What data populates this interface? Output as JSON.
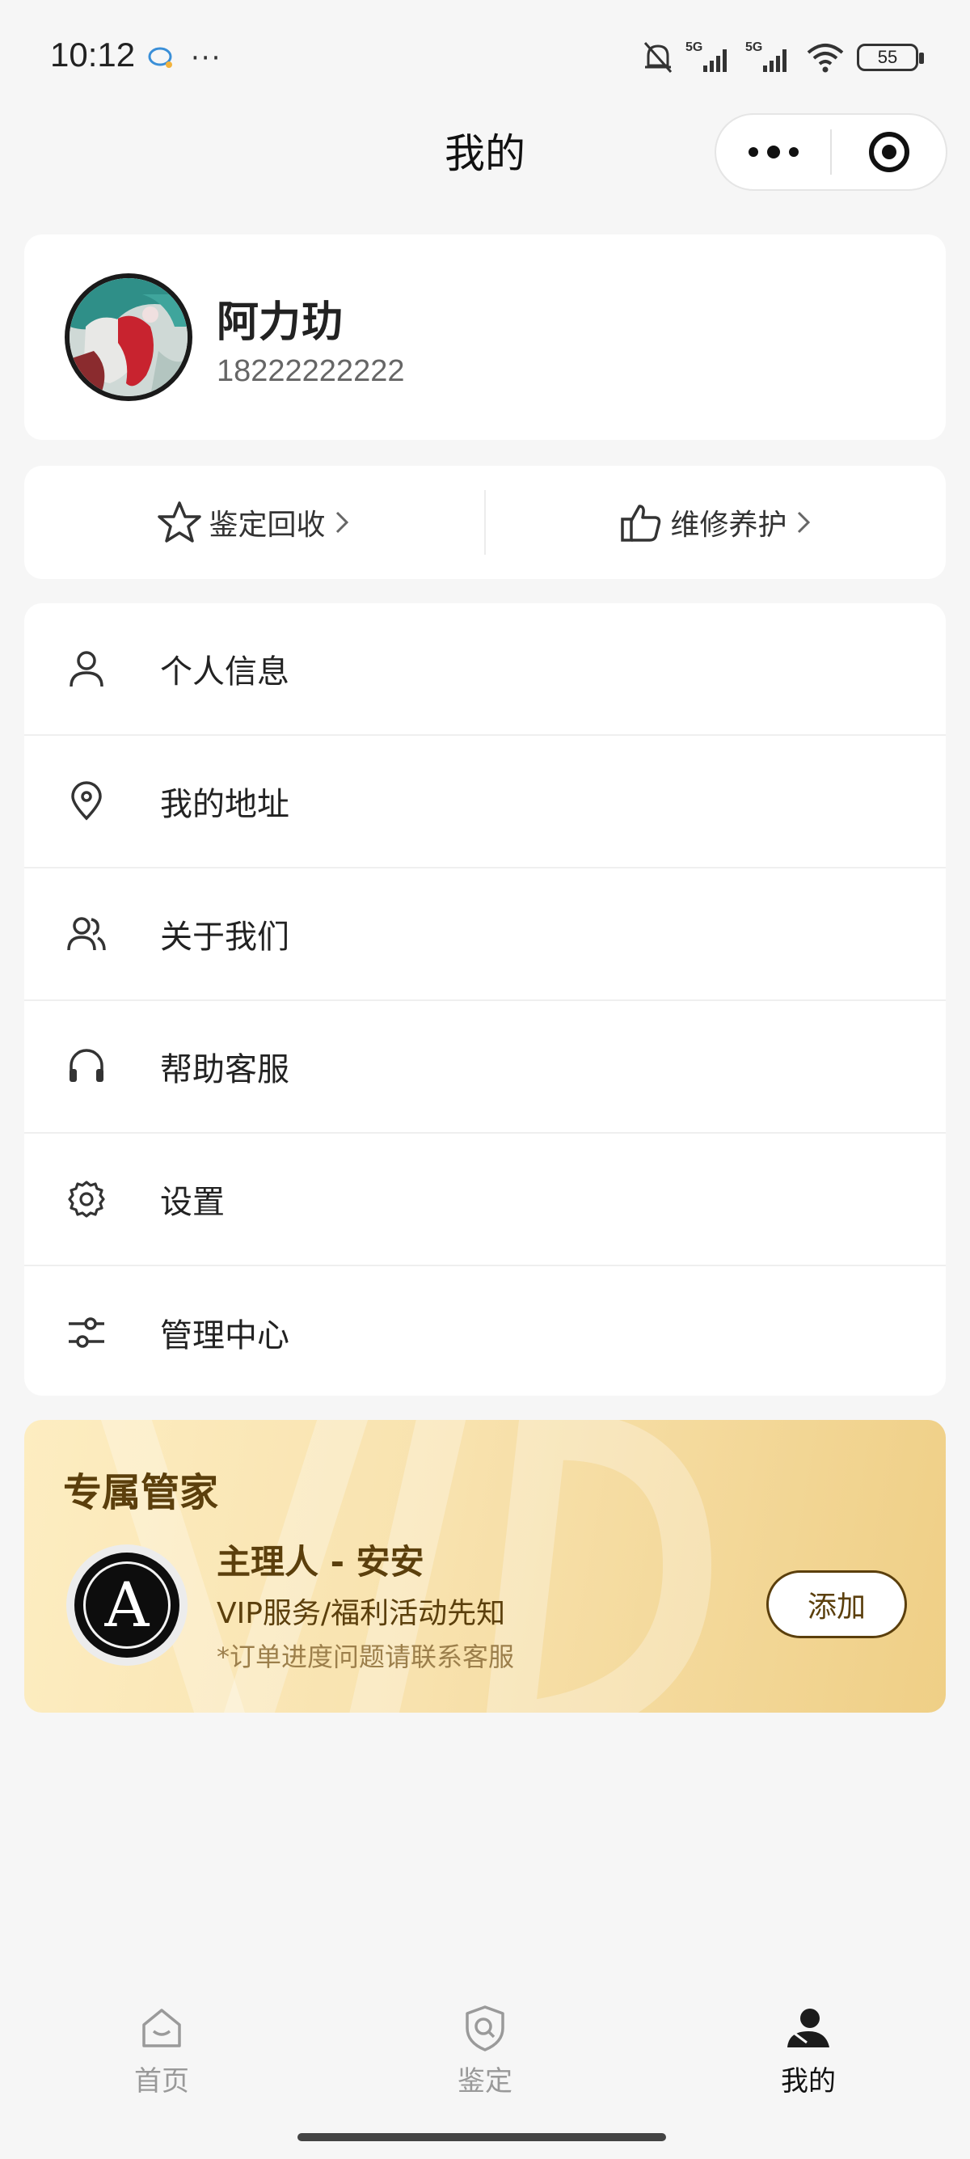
{
  "status_bar": {
    "time": "10:12",
    "dots": "···",
    "battery": "55",
    "network1": "5G",
    "network2": "5G"
  },
  "nav": {
    "title": "我的"
  },
  "profile": {
    "name": "阿力玏",
    "phone": "18222222222"
  },
  "quick_actions": [
    {
      "label": "鉴定回收",
      "icon": "star-icon"
    },
    {
      "label": "维修养护",
      "icon": "thumbs-up-icon"
    }
  ],
  "menu": [
    {
      "label": "个人信息",
      "icon": "user-icon"
    },
    {
      "label": "我的地址",
      "icon": "location-pin-icon"
    },
    {
      "label": "关于我们",
      "icon": "users-icon"
    },
    {
      "label": "帮助客服",
      "icon": "headphones-icon"
    },
    {
      "label": "设置",
      "icon": "gear-icon"
    },
    {
      "label": "管理中心",
      "icon": "sliders-icon"
    }
  ],
  "vip": {
    "title": "专属管家",
    "name": "主理人 - 安安",
    "line1": "VIP服务/福利活动先知",
    "line2": "*订单进度问题请联系客服",
    "logo_letter": "A",
    "add_label": "添加"
  },
  "tabs": [
    {
      "label": "首页",
      "icon": "home-icon",
      "active": false
    },
    {
      "label": "鉴定",
      "icon": "shield-search-icon",
      "active": false
    },
    {
      "label": "我的",
      "icon": "person-icon",
      "active": true
    }
  ],
  "colors": {
    "accent_brown": "#5b3f0c",
    "vip_gold_start": "#fdedc1",
    "vip_gold_end": "#efcf86",
    "background": "#f6f6f6"
  }
}
